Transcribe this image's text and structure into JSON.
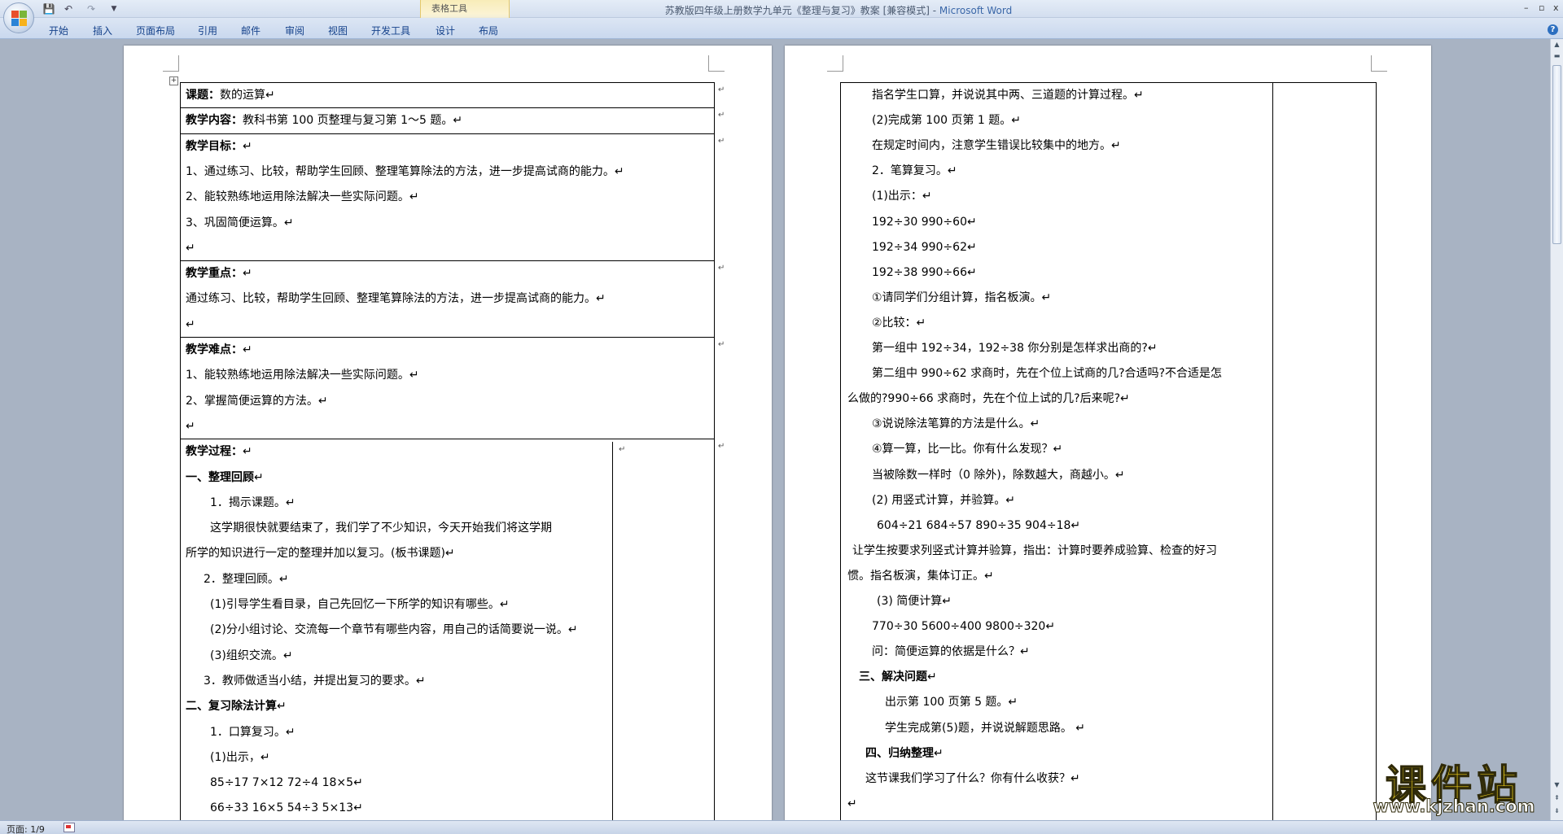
{
  "window": {
    "title_doc": "苏教版四年级上册数学九单元《整理与复习》教案 [兼容模式] - ",
    "title_app": "Microsoft Word",
    "contextual_group": "表格工具",
    "min_label": "–",
    "max_label": "▫",
    "close_label": "x"
  },
  "qat": {
    "save": "💾",
    "undo": "↶",
    "redo": "↷",
    "more": "▼"
  },
  "tabs": [
    "开始",
    "插入",
    "页面布局",
    "引用",
    "邮件",
    "审阅",
    "视图",
    "开发工具",
    "设计",
    "布局"
  ],
  "help": "?",
  "status": {
    "page": "页面: 1/9"
  },
  "para_mark": "↵",
  "left_cells": [
    {
      "lines": [
        {
          "b": "课题：",
          "t": "数的运算↵"
        }
      ]
    },
    {
      "lines": [
        {
          "b": "教学内容：",
          "t": "教科书第 100 页整理与复习第 1～5 题。↵"
        }
      ]
    },
    {
      "lines": [
        {
          "b": "教学目标：",
          "t": "↵"
        },
        {
          "b": "",
          "t": "1、通过练习、比较，帮助学生回顾、整理笔算除法的方法，进一步提高试商的能力。↵"
        },
        {
          "b": "",
          "t": "2、能较熟练地运用除法解决一些实际问题。↵"
        },
        {
          "b": "",
          "t": "3、巩固简便运算。↵"
        },
        {
          "b": "",
          "t": "↵"
        }
      ]
    },
    {
      "lines": [
        {
          "b": "教学重点：",
          "t": "↵"
        },
        {
          "b": "",
          "t": "通过练习、比较，帮助学生回顾、整理笔算除法的方法，进一步提高试商的能力。↵"
        },
        {
          "b": "",
          "t": "↵"
        }
      ]
    },
    {
      "lines": [
        {
          "b": "教学难点：",
          "t": "↵"
        },
        {
          "b": "",
          "t": "1、能较熟练地运用除法解决一些实际问题。↵"
        },
        {
          "b": "",
          "t": "2、掌握简便运算的方法。↵"
        },
        {
          "b": "",
          "t": "↵"
        }
      ]
    }
  ],
  "left_process": [
    {
      "b": "教学过程：",
      "t": "↵",
      "x": 0
    },
    {
      "b": "一、整理回顾",
      "t": "↵",
      "x": 0
    },
    {
      "b": "",
      "t": "1．揭示课题。↵",
      "x": 30
    },
    {
      "b": "",
      "t": "这学期很快就要结束了，我们学了不少知识，今天开始我们将这学期",
      "x": 30
    },
    {
      "b": "",
      "t": "所学的知识进行一定的整理并加以复习。(板书课题)↵",
      "x": 0
    },
    {
      "b": "",
      "t": "2．整理回顾。↵",
      "x": 22
    },
    {
      "b": "",
      "t": "(1)引导学生看目录，自己先回忆一下所学的知识有哪些。↵",
      "x": 30
    },
    {
      "b": "",
      "t": "(2)分小组讨论、交流每一个章节有哪些内容，用自己的话简要说一说。↵",
      "x": 30
    },
    {
      "b": "",
      "t": "(3)组织交流。↵",
      "x": 30
    },
    {
      "b": "",
      "t": "3．教师做适当小结，并提出复习的要求。↵",
      "x": 22
    },
    {
      "b": "二、复习除法计算",
      "t": "↵",
      "x": 0
    },
    {
      "b": "",
      "t": "1．口算复习。↵",
      "x": 30
    },
    {
      "b": "",
      "t": "(1)出示，↵",
      "x": 30
    },
    {
      "b": "",
      "t": "85÷17      7×12      72÷4      18×5↵",
      "x": 30
    },
    {
      "b": "",
      "t": "66÷33      16×5      54÷3      5×13↵",
      "x": 30
    }
  ],
  "right_lines": [
    {
      "b": "",
      "t": "指名学生口算，并说说其中两、三道题的计算过程。↵",
      "x": 38
    },
    {
      "b": "",
      "t": "(2)完成第 100 页第 1 题。↵",
      "x": 38
    },
    {
      "b": "",
      "t": "在规定时间内，注意学生错误比较集中的地方。↵",
      "x": 38
    },
    {
      "b": "",
      "t": "2．笔算复习。↵",
      "x": 38
    },
    {
      "b": "",
      "t": "(1)出示：↵",
      "x": 38
    },
    {
      "b": "",
      "t": "192÷30      990÷60↵",
      "x": 38
    },
    {
      "b": "",
      "t": "192÷34      990÷62↵",
      "x": 38
    },
    {
      "b": "",
      "t": "192÷38      990÷66↵",
      "x": 38
    },
    {
      "b": "",
      "t": "①请同学们分组计算，指名板演。↵",
      "x": 38
    },
    {
      "b": "",
      "t": "②比较：↵",
      "x": 38
    },
    {
      "b": "",
      "t": "第一组中 192÷34，192÷38 你分别是怎样求出商的?↵",
      "x": 38
    },
    {
      "b": "",
      "t": "第二组中 990÷62 求商时，先在个位上试商的几?合适吗?不合适是怎",
      "x": 38
    },
    {
      "b": "",
      "t": "么做的?990÷66 求商时，先在个位上试的几?后来呢?↵",
      "x": 8
    },
    {
      "b": "",
      "t": "③说说除法笔算的方法是什么。↵",
      "x": 38
    },
    {
      "b": "",
      "t": "④算一算，比一比。你有什么发现？↵",
      "x": 38
    },
    {
      "b": "",
      "t": "当被除数一样时（0 除外)，除数越大，商越小。↵",
      "x": 38
    },
    {
      "b": "",
      "t": "(2) 用竖式计算，并验算。↵",
      "x": 38
    },
    {
      "b": "",
      "t": "604÷21         684÷57         890÷35          904÷18↵",
      "x": 44
    },
    {
      "b": "",
      "t": "让学生按要求列竖式计算并验算，指出：计算时要养成验算、检查的好习",
      "x": 14
    },
    {
      "b": "",
      "t": "惯。指名板演，集体订正。↵",
      "x": 8
    },
    {
      "b": "",
      "t": "(3) 简便计算↵",
      "x": 44
    },
    {
      "b": "",
      "t": "770÷30          5600÷400          9800÷320↵",
      "x": 38
    },
    {
      "b": "",
      "t": "问：简便运算的依据是什么？↵",
      "x": 38
    },
    {
      "b": "三、解决问题",
      "t": "↵",
      "x": 22
    },
    {
      "b": "",
      "t": "出示第 100 页第 5 题。↵",
      "x": 54
    },
    {
      "b": "",
      "t": "学生完成第(5)题，并说说解题思路。    ↵",
      "x": 54
    },
    {
      "b": "四、归纳整理",
      "t": "↵",
      "x": 30
    },
    {
      "b": "",
      "t": "这节课我们学习了什么？你有什么收获？↵",
      "x": 30
    },
    {
      "b": "",
      "t": "↵",
      "x": 8
    }
  ],
  "watermark": {
    "title": "课件站",
    "url": "www.kjzhan.com"
  },
  "colors": {
    "workspace": "#a8b3c3",
    "ribbon": "#c9d8ee",
    "watermark": "#f3d31b"
  }
}
